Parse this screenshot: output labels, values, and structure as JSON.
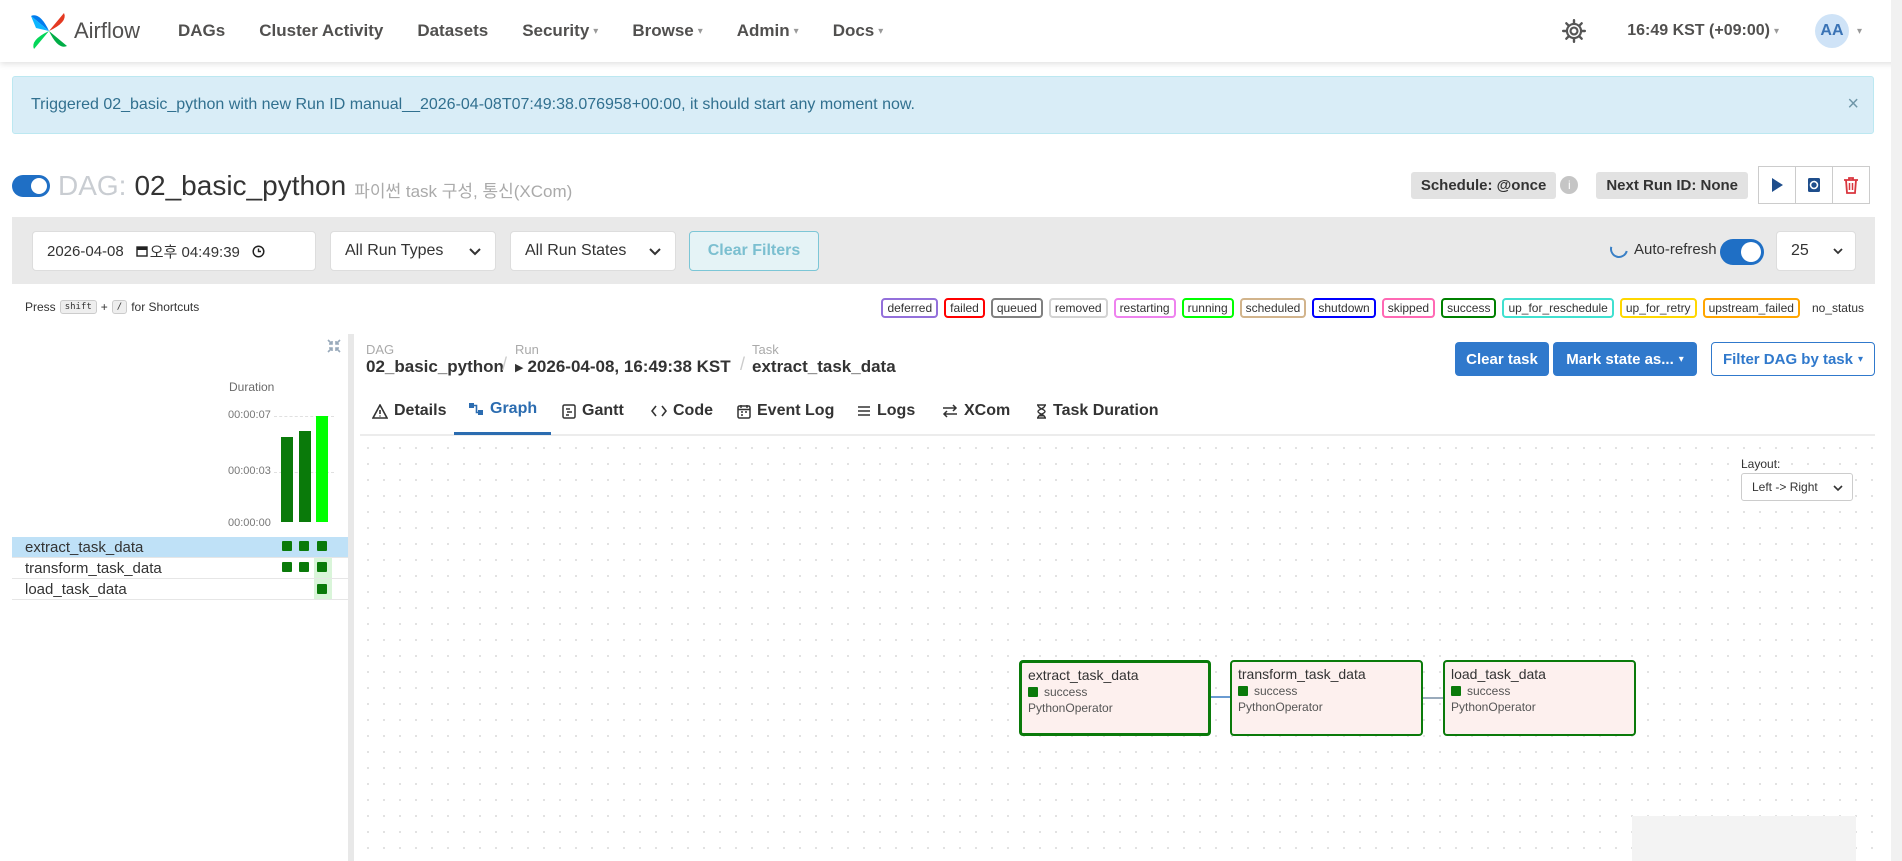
{
  "nav": {
    "brand": "Airflow",
    "items": [
      {
        "label": "DAGs",
        "caret": false
      },
      {
        "label": "Cluster Activity",
        "caret": false
      },
      {
        "label": "Datasets",
        "caret": false
      },
      {
        "label": "Security",
        "caret": true
      },
      {
        "label": "Browse",
        "caret": true
      },
      {
        "label": "Admin",
        "caret": true
      },
      {
        "label": "Docs",
        "caret": true
      }
    ],
    "clock": "16:49 KST (+09:00)",
    "avatar": "AA"
  },
  "alert": {
    "message": "Triggered 02_basic_python with new Run ID manual__2026-04-08T07:49:38.076958+00:00, it should start any moment now.",
    "close": "×"
  },
  "dag": {
    "label": "DAG:",
    "name": "02_basic_python",
    "description": "파이썬 task 구성, 통신(XCom)",
    "schedule": "Schedule: @once",
    "info": "i",
    "next_run": "Next Run ID: None"
  },
  "filters": {
    "date": "2026-04-08",
    "time": "오후 04:49:39",
    "run_types": "All Run Types",
    "run_states": "All Run States",
    "clear": "Clear Filters",
    "auto_refresh": "Auto-refresh",
    "num_runs": "25"
  },
  "shortcuts": {
    "press": "Press",
    "key1": "shift",
    "plus": "+",
    "key2": "/",
    "suffix": "for Shortcuts"
  },
  "legend": [
    {
      "label": "deferred",
      "color": "#9370db"
    },
    {
      "label": "failed",
      "color": "#ff0000"
    },
    {
      "label": "queued",
      "color": "#808080"
    },
    {
      "label": "removed",
      "color": "#d3d3d3"
    },
    {
      "label": "restarting",
      "color": "#ee82ee"
    },
    {
      "label": "running",
      "color": "#00ff00"
    },
    {
      "label": "scheduled",
      "color": "#d2b48c"
    },
    {
      "label": "shutdown",
      "color": "#0000ff"
    },
    {
      "label": "skipped",
      "color": "#ff69b4"
    },
    {
      "label": "success",
      "color": "#008000"
    },
    {
      "label": "up_for_reschedule",
      "color": "#40e0d0"
    },
    {
      "label": "up_for_retry",
      "color": "#ffd700"
    },
    {
      "label": "upstream_failed",
      "color": "#ffa500"
    }
  ],
  "legend_plain": "no_status",
  "grid": {
    "duration_label": "Duration",
    "ticks": [
      "00:00:07",
      "00:00:03",
      "00:00:00"
    ],
    "runs": [
      {
        "duration_s": 5.6,
        "state": "success"
      },
      {
        "duration_s": 6.0,
        "state": "success"
      },
      {
        "duration_s": 7.0,
        "state": "running"
      }
    ],
    "tasks": [
      "extract_task_data",
      "transform_task_data",
      "load_task_data"
    ]
  },
  "details": {
    "dag_lbl": "DAG",
    "dag_val": "02_basic_python",
    "run_lbl": "Run",
    "run_val": "2026-04-08, 16:49:38 KST",
    "task_lbl": "Task",
    "task_val": "extract_task_data",
    "clear_task": "Clear task",
    "mark_state": "Mark state as...",
    "filter_dag": "Filter DAG by task"
  },
  "tabs": [
    "Details",
    "Graph",
    "Gantt",
    "Code",
    "Event Log",
    "Logs",
    "XCom",
    "Task Duration"
  ],
  "active_tab": "Graph",
  "graph": {
    "layout_label": "Layout:",
    "layout_value": "Left -> Right",
    "nodes": [
      {
        "name": "extract_task_data",
        "state": "success",
        "operator": "PythonOperator"
      },
      {
        "name": "transform_task_data",
        "state": "success",
        "operator": "PythonOperator"
      },
      {
        "name": "load_task_data",
        "state": "success",
        "operator": "PythonOperator"
      }
    ]
  },
  "colors": {
    "primary": "#3079cc",
    "success": "#008000",
    "running": "#00ff00"
  }
}
